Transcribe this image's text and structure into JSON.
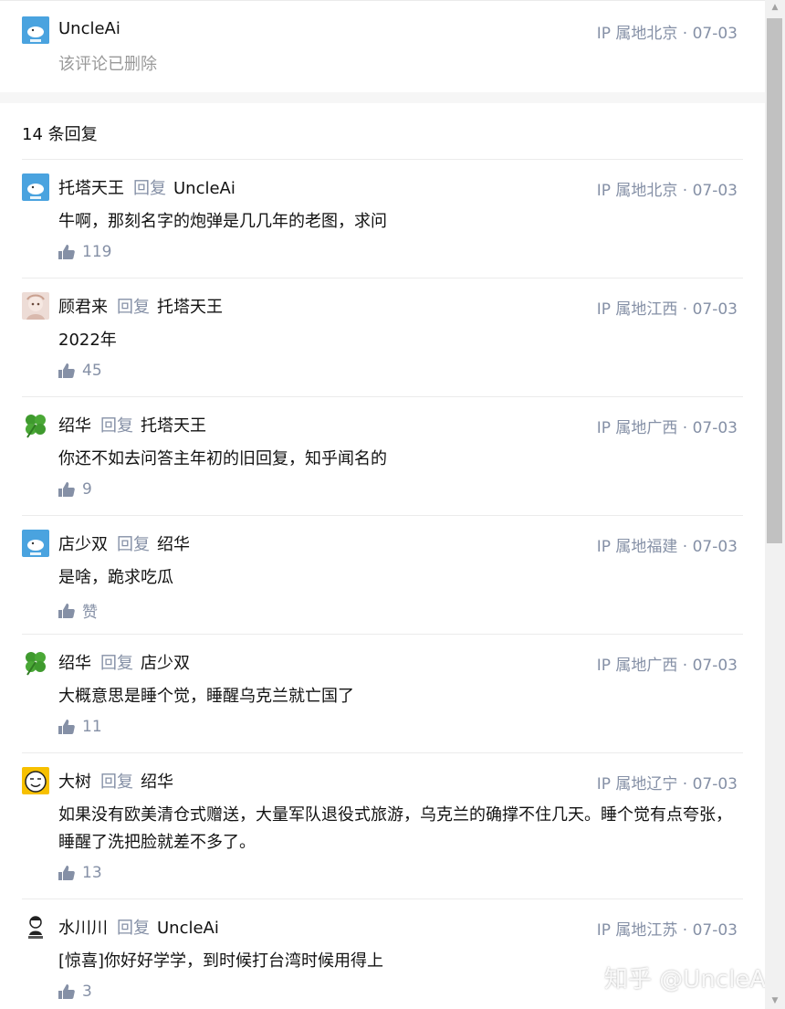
{
  "top_comment": {
    "username": "UncleAi",
    "meta": "IP 属地北京 · 07-03",
    "text": "该评论已删除"
  },
  "reply_count": "14 条回复",
  "reply_word": "回复",
  "replies": [
    {
      "author": "托塔天王",
      "reply_to": "UncleAi",
      "meta": "IP 属地北京 · 07-03",
      "content": "牛啊，那刻名字的炮弹是几几年的老图，求问",
      "likes": "119",
      "avatar": "whale"
    },
    {
      "author": "顾君来",
      "reply_to": "托塔天王",
      "meta": "IP 属地江西 · 07-03",
      "content": "2022年",
      "likes": "45",
      "avatar": "photo"
    },
    {
      "author": "绍华",
      "reply_to": "托塔天王",
      "meta": "IP 属地广西 · 07-03",
      "content": "你还不如去问答主年初的旧回复，知乎闻名的",
      "likes": "9",
      "avatar": "clover"
    },
    {
      "author": "店少双",
      "reply_to": "绍华",
      "meta": "IP 属地福建 · 07-03",
      "content": "是啥，跪求吃瓜",
      "likes": "赞",
      "avatar": "whale"
    },
    {
      "author": "绍华",
      "reply_to": "店少双",
      "meta": "IP 属地广西 · 07-03",
      "content": "大概意思是睡个觉，睡醒乌克兰就亡国了",
      "likes": "11",
      "avatar": "clover"
    },
    {
      "author": "大树",
      "reply_to": "绍华",
      "meta": "IP 属地辽宁 · 07-03",
      "content": "如果没有欧美清仓式赠送，大量军队退役式旅游，乌克兰的确撑不住几天。睡个觉有点夸张，睡醒了洗把脸就差不多了。",
      "likes": "13",
      "avatar": "face"
    },
    {
      "author": "水川川",
      "reply_to": "UncleAi",
      "meta": "IP 属地江苏 · 07-03",
      "content": "[惊喜]你好好学学，到时候打台湾时候用得上",
      "likes": "3",
      "avatar": "cartoon"
    }
  ],
  "watermark": "知乎 @UncleAi",
  "colors": {
    "meta": "#8590a6",
    "text": "#121212",
    "divider": "#ebebeb",
    "band": "#f6f6f6"
  }
}
